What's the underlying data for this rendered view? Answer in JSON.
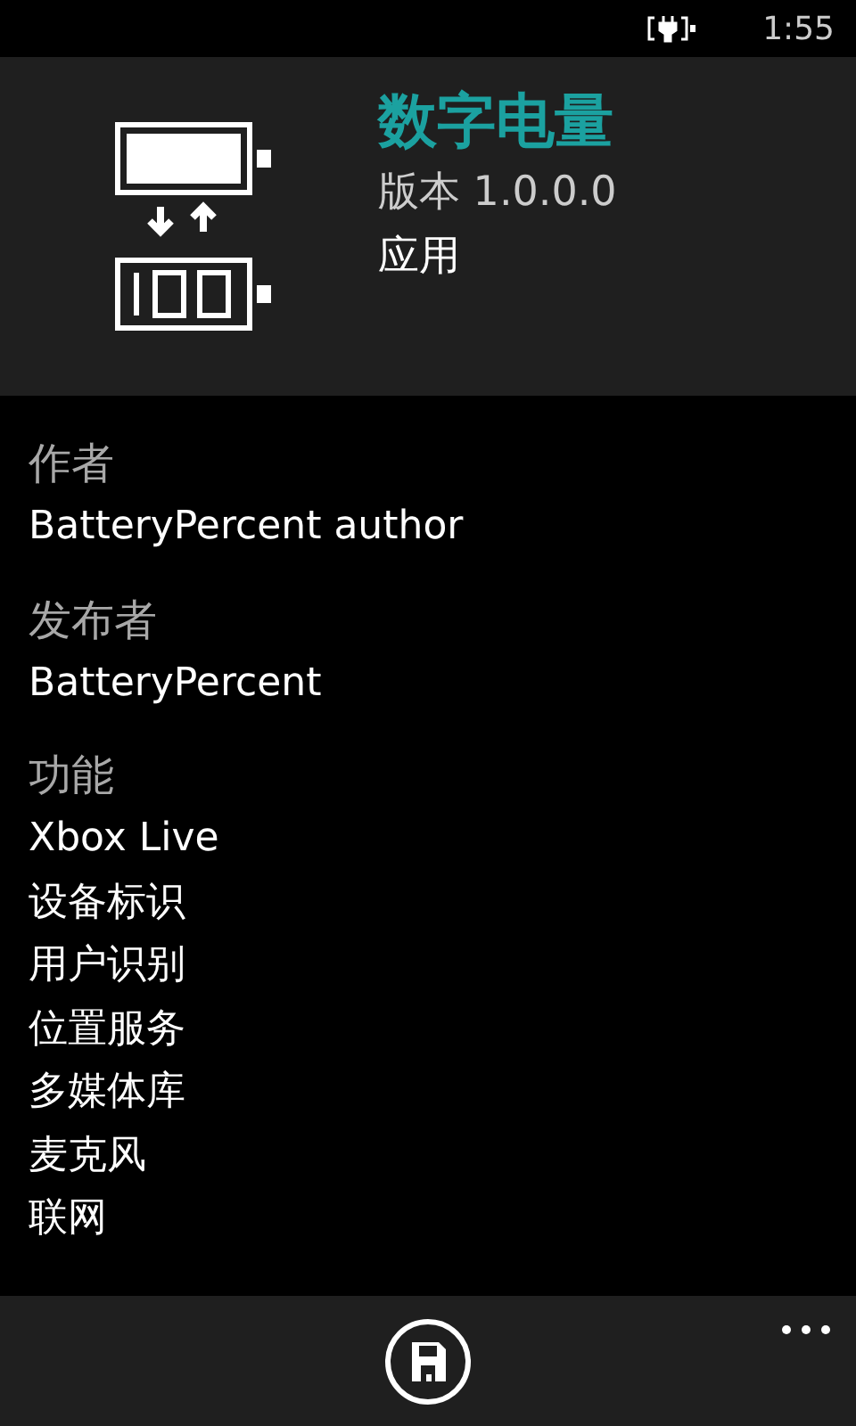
{
  "status_bar": {
    "charging": true,
    "time": "1:55"
  },
  "app": {
    "title": "数字电量",
    "version": "版本 1.0.0.0",
    "type": "应用"
  },
  "sections": [
    {
      "heading": "作者",
      "items": [
        "BatteryPercent author"
      ]
    },
    {
      "heading": "发布者",
      "items": [
        "BatteryPercent"
      ]
    },
    {
      "heading": "功能",
      "items": [
        "Xbox Live",
        "设备标识",
        "用户识别",
        "位置服务",
        "多媒体库",
        "麦克风",
        "联网"
      ]
    }
  ]
}
